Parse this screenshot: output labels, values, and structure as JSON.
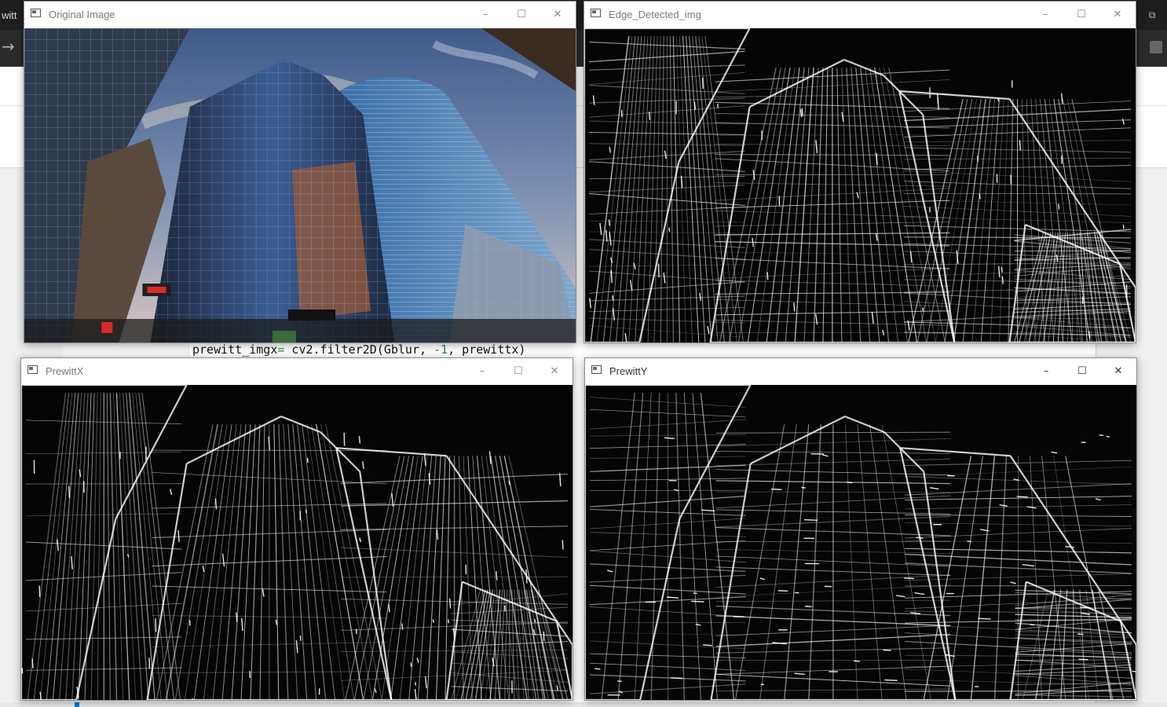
{
  "ide": {
    "title_fragment": "witt",
    "restore_glyph": "⧉",
    "back_glyph": "→",
    "code_line": {
      "a": "prewitt_imgx",
      "op": "=",
      "b": " cv2.filter2D(Gblur, ",
      "neg": "-1",
      "c": ", prewittx)"
    }
  },
  "windows": [
    {
      "key": "original",
      "title": "Original Image",
      "active": false,
      "kind": "photo"
    },
    {
      "key": "edge",
      "title": "Edge_Detected_img",
      "active": false,
      "kind": "edges-mixed"
    },
    {
      "key": "prewittx",
      "title": "PrewittX",
      "active": false,
      "kind": "edges-x"
    },
    {
      "key": "prewitty",
      "title": "PrewittY",
      "active": true,
      "kind": "edges-y"
    }
  ],
  "controls": {
    "minimize": "–",
    "maximize": "☐",
    "close": "✕"
  }
}
